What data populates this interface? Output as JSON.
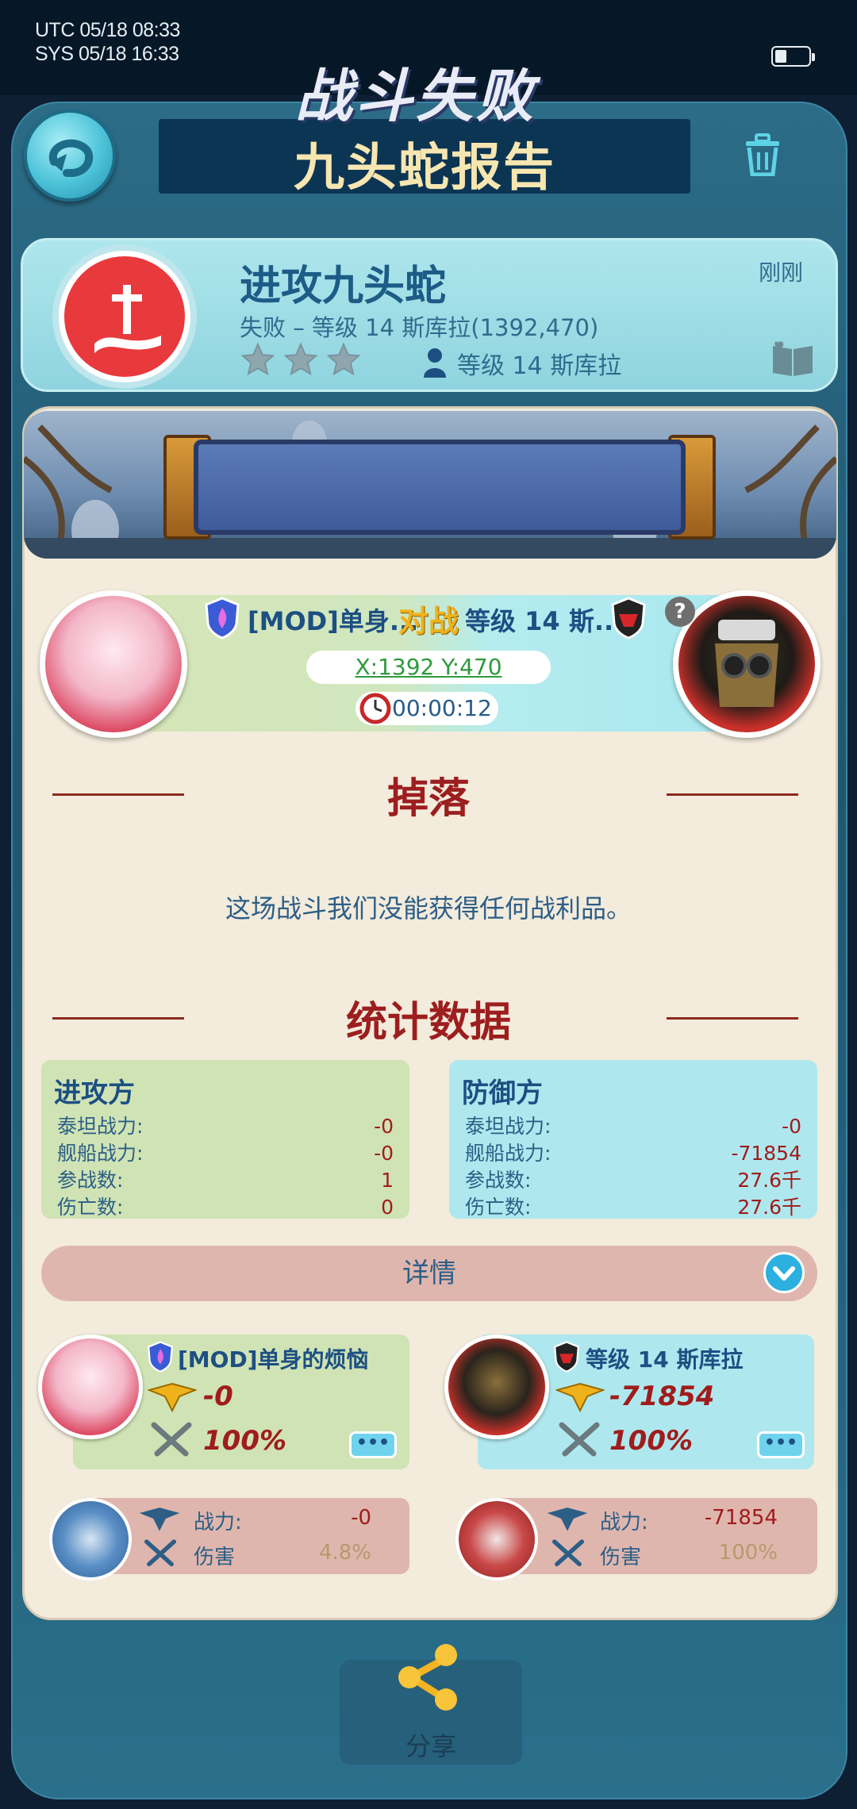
{
  "status_bar": {
    "utc": "UTC 05/18 08:33",
    "sys": "SYS 05/18 16:33"
  },
  "header": {
    "title": "九头蛇报告"
  },
  "report": {
    "title": "进攻九头蛇",
    "subtitle": "失败 – 等级 14 斯库拉(1392,470)",
    "time": "刚刚",
    "stars_earned": 0,
    "stars_total": 3,
    "target": "等级 14 斯库拉"
  },
  "banner": {
    "result": "战斗失败"
  },
  "battle": {
    "attacker_name": "[MOD]单身...",
    "vs_label": "对战",
    "defender_name": "等级 14 斯...",
    "help": "?",
    "coordinates": "X:1392 Y:470",
    "duration": "00:00:12"
  },
  "loot": {
    "title": "掉落",
    "message": "这场战斗我们没能获得任何战利品。"
  },
  "stats": {
    "title": "统计数据",
    "attacker": {
      "heading": "进攻方",
      "rows": [
        {
          "label": "泰坦战力:",
          "value": "-0"
        },
        {
          "label": "舰船战力:",
          "value": "-0"
        },
        {
          "label": "参战数:",
          "value": "1"
        },
        {
          "label": "伤亡数:",
          "value": "0"
        }
      ]
    },
    "defender": {
      "heading": "防御方",
      "rows": [
        {
          "label": "泰坦战力:",
          "value": "-0"
        },
        {
          "label": "舰船战力:",
          "value": "-71854"
        },
        {
          "label": "参战数:",
          "value": "27.6千"
        },
        {
          "label": "伤亡数:",
          "value": "27.6千"
        }
      ]
    }
  },
  "details": {
    "label": "详情"
  },
  "players": {
    "attacker": {
      "name": "[MOD]单身的烦恼",
      "power": "-0",
      "percent": "100%",
      "more": "•••",
      "unit": {
        "power_label": "战力:",
        "power": "-0",
        "damage_label": "伤害",
        "damage": "4.8%"
      }
    },
    "defender": {
      "name": "等级 14 斯库拉",
      "power": "-71854",
      "percent": "100%",
      "more": "•••",
      "unit": {
        "power_label": "战力:",
        "power": "-71854",
        "damage_label": "伤害",
        "damage": "100%"
      }
    }
  },
  "share": {
    "label": "分享"
  },
  "colors": {
    "accent_red": "#a01c1c",
    "title_gold": "#f7e6b0",
    "attacker_green": "#cfe3b4",
    "defender_cyan": "#aee8ee"
  },
  "icons": [
    "back-arrow-icon",
    "trash-icon",
    "attack-flag-icon",
    "star-icon",
    "person-icon",
    "book-icon",
    "shield-icon",
    "clock-icon",
    "help-icon",
    "chevron-down-icon",
    "rank-wings-icon",
    "crossed-swords-icon",
    "share-icon"
  ]
}
